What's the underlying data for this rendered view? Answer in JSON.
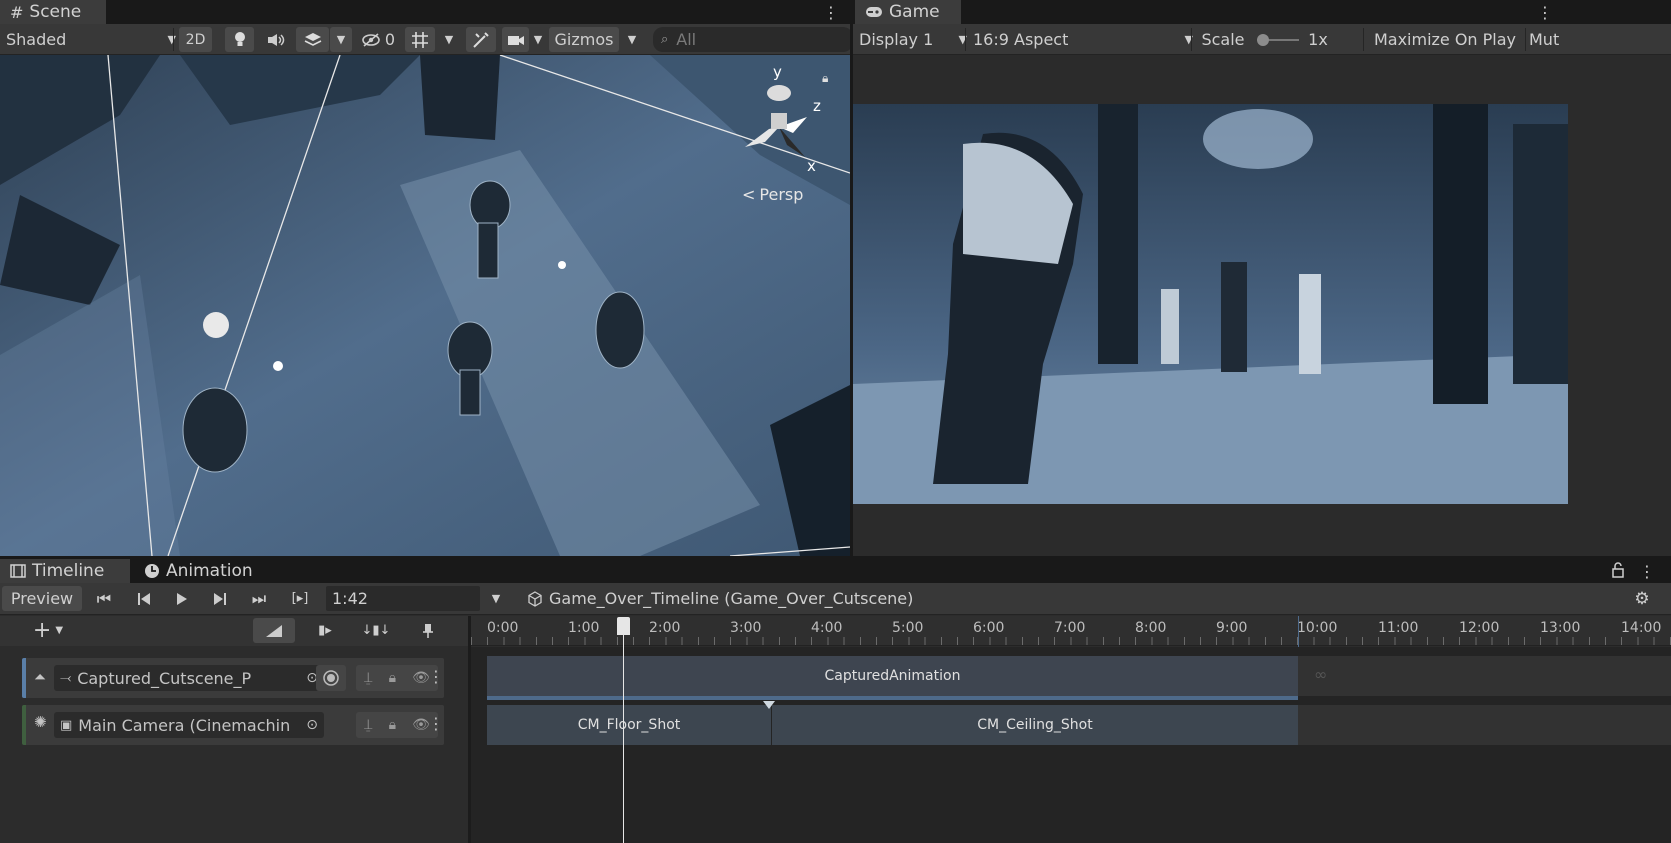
{
  "scene": {
    "tab_label": "Scene",
    "shading_mode": "Shaded",
    "btn_2d": "2D",
    "hidden_count": "0",
    "gizmos_label": "Gizmos",
    "search_placeholder": "All",
    "gizmo_axes": {
      "y": "y",
      "z": "z",
      "x": "x"
    },
    "projection_label": "Persp"
  },
  "game": {
    "tab_label": "Game",
    "display": "Display 1",
    "aspect": "16:9 Aspect",
    "scale_label": "Scale",
    "scale_value": "1x",
    "maximize_label": "Maximize On Play",
    "mute_label_partial": "Mut"
  },
  "timeline": {
    "tab_label": "Timeline",
    "animation_tab_label": "Animation",
    "preview_label": "Preview",
    "current_time": "1:42",
    "asset_name": "Game_Over_Timeline (Game_Over_Cutscene)",
    "ruler_labels": [
      "0:00",
      "1:00",
      "2:00",
      "3:00",
      "4:00",
      "5:00",
      "6:00",
      "7:00",
      "8:00",
      "9:00",
      "10:00",
      "11:00",
      "12:00",
      "13:00",
      "14:00"
    ],
    "tracks": [
      {
        "name": "Captured_Cutscene_P",
        "clips": [
          {
            "label": "CapturedAnimation"
          }
        ]
      },
      {
        "name": "Main Camera (Cinemachin",
        "clips": [
          {
            "label": "CM_Floor_Shot"
          },
          {
            "label": "CM_Ceiling_Shot"
          }
        ]
      }
    ]
  },
  "colors": {
    "editor_bg": "#191919",
    "panel_bg": "#383838",
    "scene_tint": "#4f6a88",
    "clip_bg": "#3d4650",
    "track_accent": "#5a7fa8"
  }
}
